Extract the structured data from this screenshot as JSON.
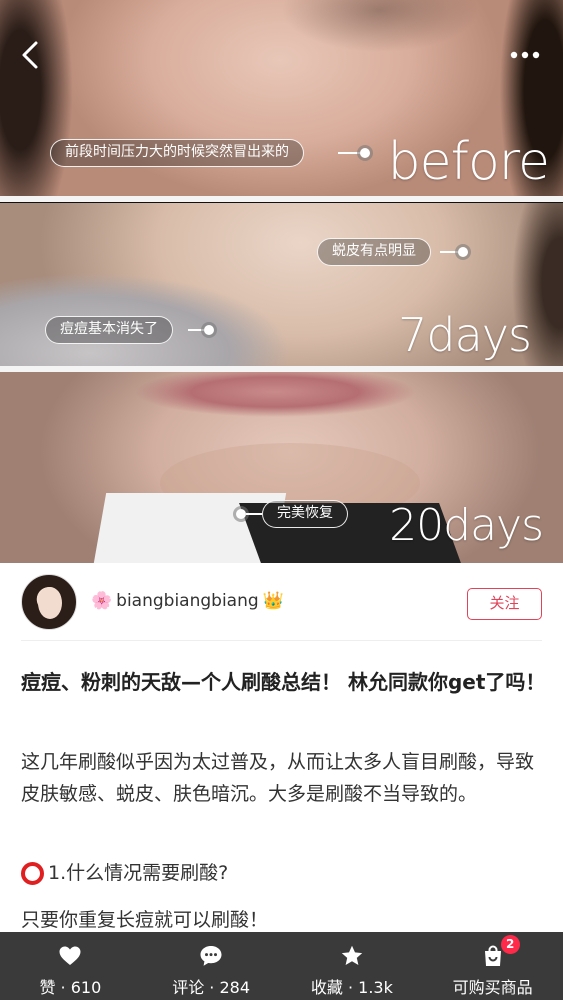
{
  "hero": {
    "panels": [
      {
        "label": "before",
        "tags": [
          "前段时间压力大的时候突然冒出来的"
        ]
      },
      {
        "label": "7days",
        "tags": [
          "蜕皮有点明显",
          "痘痘基本消失了"
        ]
      },
      {
        "label": "20days",
        "tags": [
          "完美恢复"
        ]
      }
    ]
  },
  "nav": {
    "back_icon": "back-arrow-icon",
    "more_icon": "more-dots-icon"
  },
  "author": {
    "name_prefix_icon": "🌸",
    "name": "biangbiangbiang",
    "name_suffix_icon": "👑",
    "follow_label": "关注"
  },
  "post": {
    "title": "痘痘、粉刺的天敌—个人刷酸总结！ 林允同款你get了吗！",
    "paragraph": "这几年刷酸似乎因为太过普及，从而让太多人盲目刷酸，导致皮肤敏感、蜕皮、肤色暗沉。大多是刷酸不当导致的。",
    "question_1": "1.什么情况需要刷酸?",
    "line_3": "只要你重复长痘就可以刷酸！"
  },
  "bottom_bar": {
    "like_label": "赞 · 610",
    "comment_label": "评论 · 284",
    "collect_label": "收藏 · 1.3k",
    "shop_label": "可购买商品",
    "shop_badge": "2"
  },
  "colors": {
    "accent": "#e0445a",
    "bar_bg": "#3a3a3a",
    "badge": "#ff2a4a"
  }
}
